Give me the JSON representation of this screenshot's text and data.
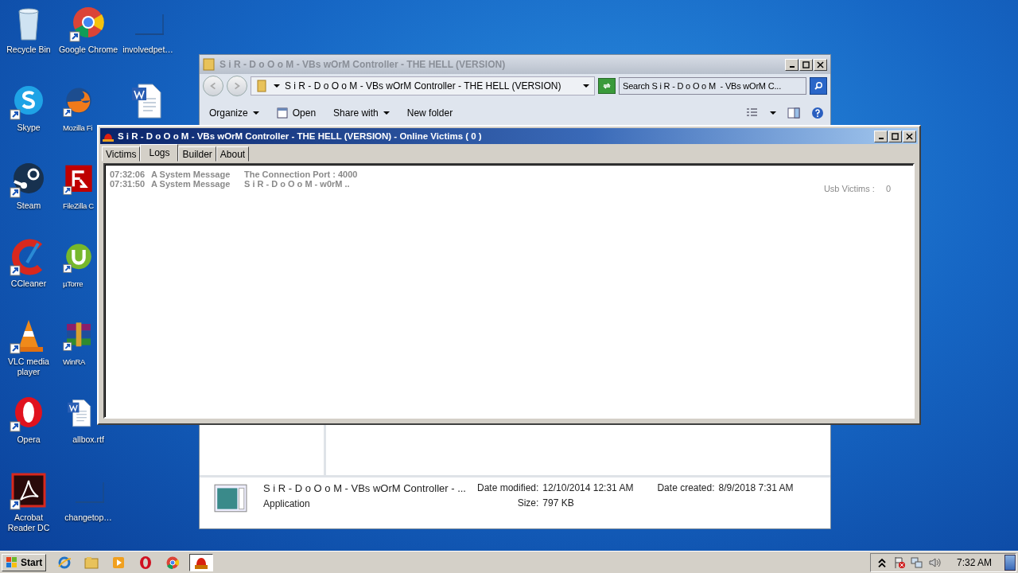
{
  "desktop_icons": [
    {
      "label": "Recycle Bin",
      "kind": "recycle",
      "shortcut": false
    },
    {
      "label": "Skype",
      "kind": "skype",
      "shortcut": true
    },
    {
      "label": "Steam",
      "kind": "steam",
      "shortcut": true
    },
    {
      "label": "CCleaner",
      "kind": "ccleaner",
      "shortcut": true
    },
    {
      "label": "VLC media player",
      "kind": "vlc",
      "shortcut": true
    },
    {
      "label": "Opera",
      "kind": "opera",
      "shortcut": true
    },
    {
      "label": "Acrobat Reader DC",
      "kind": "acrobat",
      "shortcut": true
    },
    {
      "label": "Google Chrome",
      "kind": "chrome",
      "shortcut": true
    },
    {
      "label": "Mozilla Fi",
      "kind": "firefox",
      "shortcut": true
    },
    {
      "label": "FileZilla C",
      "kind": "filezilla",
      "shortcut": true
    },
    {
      "label": "µTorre",
      "kind": "utorrent",
      "shortcut": true
    },
    {
      "label": "WinRA",
      "kind": "winrar",
      "shortcut": true
    },
    {
      "label": "allbox.rtf",
      "kind": "word",
      "shortcut": false
    },
    {
      "label": "changetop…",
      "kind": "blank",
      "shortcut": false
    },
    {
      "label": "involvedpet…",
      "kind": "blank",
      "shortcut": false
    },
    {
      "kind": "word",
      "shortcut": false
    }
  ],
  "explorer": {
    "title": "S i R - D o O o M  - VBs wOrM Controller - THE HELL (VERSION)",
    "address": "S i R - D o O o M  - VBs wOrM Controller - THE HELL (VERSION)",
    "search": {
      "placeholder": "Search S i R - D o O o M  - VBs wOrM C..."
    },
    "toolbar": [
      {
        "label": "Organize",
        "dropdown": true,
        "has_icon": false
      },
      {
        "label": "Open",
        "dropdown": false,
        "has_icon": true
      },
      {
        "label": "Share with",
        "dropdown": true,
        "has_icon": false
      },
      {
        "label": "New folder",
        "dropdown": false,
        "has_icon": false
      }
    ],
    "details": {
      "name": "S i R - D o O o M  - VBs wOrM Controller - ...",
      "type": "Application",
      "date_modified_label": "Date modified:",
      "date_modified": "12/10/2014 12:31 AM",
      "date_created_label": "Date created:",
      "date_created": "8/9/2018 7:31 AM",
      "size_label": "Size:",
      "size": "797 KB"
    }
  },
  "controller": {
    "title": "S i R - D o O o M  - VBs wOrM Controller - THE HELL (VERSION) - Online Victims ( 0 )",
    "tabs": [
      {
        "label": "Victims",
        "selected": false
      },
      {
        "label": "Logs",
        "selected": true
      },
      {
        "label": "Builder",
        "selected": false
      },
      {
        "label": "About",
        "selected": false
      }
    ],
    "logs": [
      {
        "time": "07:32:06",
        "source": "A System Message",
        "message": "The Connection Port : 4000"
      },
      {
        "time": "07:31:50",
        "source": "A System Message",
        "message": "S i R - D o O o M - w0rM .."
      }
    ],
    "usb_label": "Usb Victims :",
    "usb_count": "0"
  },
  "taskbar": {
    "start": "Start",
    "apps": [
      {
        "kind": "ie",
        "active": false
      },
      {
        "kind": "folder",
        "active": false
      },
      {
        "kind": "media",
        "active": false
      },
      {
        "kind": "opera",
        "active": false
      },
      {
        "kind": "chrome",
        "active": false
      },
      {
        "kind": "app",
        "active": true
      }
    ],
    "clock": "7:32 AM"
  }
}
